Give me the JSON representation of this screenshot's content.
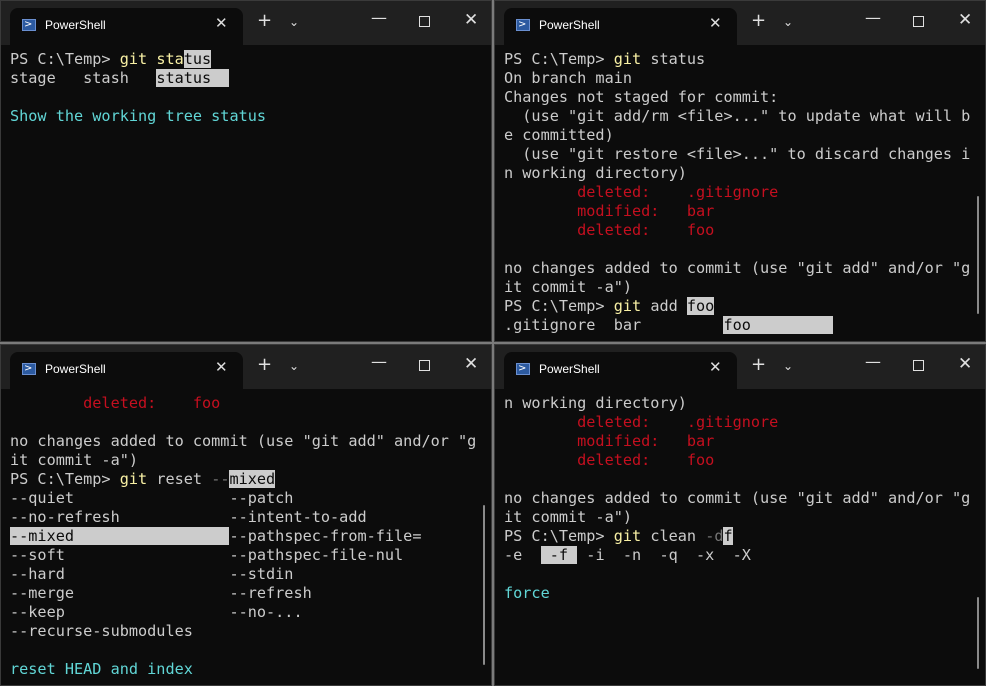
{
  "tab_title": "PowerShell",
  "windows": [
    {
      "lines": [
        [
          {
            "t": "PS C:\\Temp> "
          },
          {
            "t": "git ",
            "c": "y"
          },
          {
            "t": "sta",
            "c": "y"
          },
          {
            "t": "tus",
            "c": "hl"
          }
        ],
        [
          {
            "t": "stage   stash   "
          },
          {
            "t": "status  ",
            "c": "hl"
          }
        ],
        [],
        [
          {
            "t": "Show the working tree status",
            "c": "c"
          }
        ]
      ]
    },
    {
      "lines": [
        [
          {
            "t": "PS C:\\Temp> "
          },
          {
            "t": "git",
            "c": "y"
          },
          {
            "t": " status"
          }
        ],
        [
          {
            "t": "On branch main"
          }
        ],
        [
          {
            "t": "Changes not staged for commit:"
          }
        ],
        [
          {
            "t": "  (use \"git add/rm <file>...\" to update what will b"
          }
        ],
        [
          {
            "t": "e committed)"
          }
        ],
        [
          {
            "t": "  (use \"git restore <file>...\" to discard changes i"
          }
        ],
        [
          {
            "t": "n working directory)"
          }
        ],
        [
          {
            "t": "        deleted:    .gitignore",
            "c": "r"
          }
        ],
        [
          {
            "t": "        modified:   bar",
            "c": "r"
          }
        ],
        [
          {
            "t": "        deleted:    foo",
            "c": "r"
          }
        ],
        [],
        [
          {
            "t": "no changes added to commit (use \"git add\" and/or \"g"
          }
        ],
        [
          {
            "t": "it commit -a\")"
          }
        ],
        [
          {
            "t": "PS C:\\Temp> "
          },
          {
            "t": "git",
            "c": "y"
          },
          {
            "t": " add "
          },
          {
            "t": "foo",
            "c": "hl"
          }
        ],
        [
          {
            "t": ".gitignore  bar         "
          },
          {
            "t": "foo         ",
            "c": "hl"
          }
        ]
      ]
    },
    {
      "lines": [
        [
          {
            "t": "        deleted:    foo",
            "c": "r"
          }
        ],
        [],
        [
          {
            "t": "no changes added to commit (use \"git add\" and/or \"g"
          }
        ],
        [
          {
            "t": "it commit -a\")"
          }
        ],
        [
          {
            "t": "PS C:\\Temp> "
          },
          {
            "t": "git",
            "c": "y"
          },
          {
            "t": " reset "
          },
          {
            "t": "--",
            "c": "g"
          },
          {
            "t": "mixed",
            "c": "hl"
          }
        ],
        [
          {
            "t": "--quiet                 --patch"
          }
        ],
        [
          {
            "t": "--no-refresh            --intent-to-add"
          }
        ],
        [
          {
            "t": "--mixed                 ",
            "c": "hl"
          },
          {
            "t": "--pathspec-from-file="
          }
        ],
        [
          {
            "t": "--soft                  --pathspec-file-nul"
          }
        ],
        [
          {
            "t": "--hard                  --stdin"
          }
        ],
        [
          {
            "t": "--merge                 --refresh"
          }
        ],
        [
          {
            "t": "--keep                  --no-..."
          }
        ],
        [
          {
            "t": "--recurse-submodules"
          }
        ],
        [],
        [
          {
            "t": "reset HEAD and index",
            "c": "c"
          }
        ]
      ]
    },
    {
      "lines": [
        [
          {
            "t": "n working directory)"
          }
        ],
        [
          {
            "t": "        deleted:    .gitignore",
            "c": "r"
          }
        ],
        [
          {
            "t": "        modified:   bar",
            "c": "r"
          }
        ],
        [
          {
            "t": "        deleted:    foo",
            "c": "r"
          }
        ],
        [],
        [
          {
            "t": "no changes added to commit (use \"git add\" and/or \"g"
          }
        ],
        [
          {
            "t": "it commit -a\")"
          }
        ],
        [
          {
            "t": "PS C:\\Temp> "
          },
          {
            "t": "git",
            "c": "y"
          },
          {
            "t": " clean "
          },
          {
            "t": "-d",
            "c": "g"
          },
          {
            "t": "f",
            "c": "hl"
          }
        ],
        [
          {
            "t": "-e  "
          },
          {
            "t": " -f ",
            "c": "hl"
          },
          {
            "t": " -i  -n  -q  -x  -X"
          }
        ],
        [],
        [
          {
            "t": "force",
            "c": "c"
          }
        ]
      ]
    }
  ]
}
